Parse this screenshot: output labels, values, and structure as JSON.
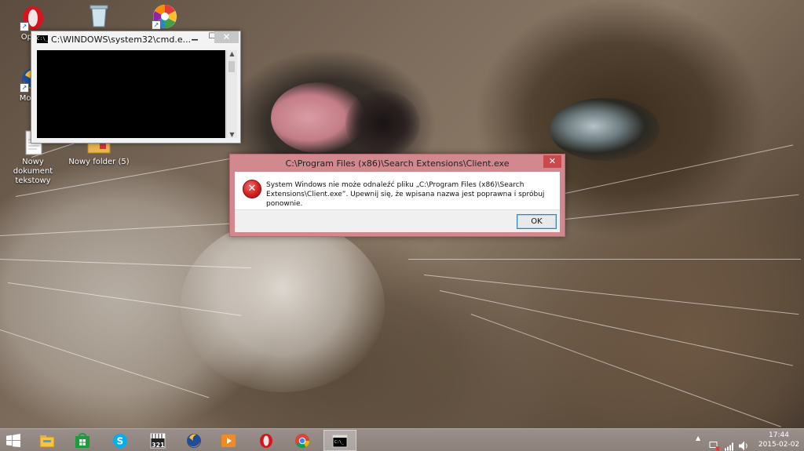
{
  "desktop": {
    "icons": [
      {
        "label": "Opera"
      },
      {
        "label": ""
      },
      {
        "label": ""
      },
      {
        "label": "Mozilla"
      },
      {
        "label": "Nowy dokument tekstowy"
      },
      {
        "label": "Nowy folder (5)"
      }
    ]
  },
  "cmd_window": {
    "title": "C:\\WINDOWS\\system32\\cmd.e...",
    "icon_text": "C:\\_",
    "minimize": "▁",
    "maximize": "☐",
    "close": "✕"
  },
  "error_dialog": {
    "title": "C:\\Program Files (x86)\\Search Extensions\\Client.exe",
    "message": "System Windows nie może odnaleźć pliku „C:\\Program Files (x86)\\Search Extensions\\Client.exe”. Upewnij się, że wpisana nazwa jest poprawna i spróbuj ponownie.",
    "ok_label": "OK",
    "close": "✕",
    "icon_glyph": "✕"
  },
  "taskbar": {
    "start_icon": "windows-logo",
    "pinned": [
      {
        "name": "file-explorer"
      },
      {
        "name": "store"
      },
      {
        "name": "skype"
      },
      {
        "name": "media-player-classic"
      },
      {
        "name": "firefox"
      },
      {
        "name": "media-player"
      },
      {
        "name": "opera"
      },
      {
        "name": "chrome"
      },
      {
        "name": "cmd",
        "active": true
      }
    ],
    "media_badge": "321",
    "clock": {
      "time": "17:44",
      "date": "2015-02-02"
    },
    "tray_arrow": "▲"
  },
  "colors": {
    "dialog_frame": "#d1888e",
    "taskbar": "#938883",
    "error_red": "#d0211f",
    "ok_border": "#3c7fb1"
  }
}
